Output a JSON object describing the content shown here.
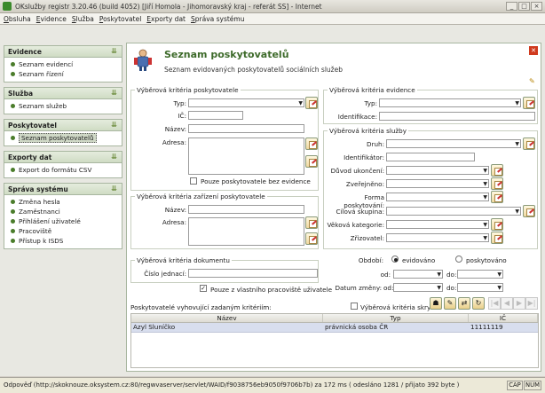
{
  "window": {
    "title": "OKslužby registr 3.20.46 (build 4052) [Jiří Homola - Jihomoravský kraj - referát SS] - Internet",
    "controls": [
      "_",
      "□",
      "×"
    ]
  },
  "menu": [
    "Obsluha",
    "Evidence",
    "Služba",
    "Poskytovatel",
    "Exporty dat",
    "Správa systému"
  ],
  "sidebar": [
    {
      "title": "Evidence",
      "items": [
        "Seznam evidencí",
        "Seznam řízení"
      ]
    },
    {
      "title": "Služba",
      "items": [
        "Seznam služeb"
      ]
    },
    {
      "title": "Poskytovatel",
      "items": [
        "Seznam poskytovatelů"
      ],
      "active": 0
    },
    {
      "title": "Exporty dat",
      "items": [
        "Export do formátu CSV"
      ]
    },
    {
      "title": "Správa systému",
      "items": [
        "Změna hesla",
        "Zaměstnanci",
        "Přihlášení uživatelé",
        "Pracoviště",
        "Přístup k ISDS"
      ]
    }
  ],
  "page": {
    "title": "Seznam poskytovatelů",
    "subtitle": "Seznam evidovaných poskytovatelů sociálních služeb"
  },
  "provider_criteria": {
    "legend": "Výběrová kritéria poskytovatele",
    "typ": "Typ:",
    "ic": "IČ:",
    "nazev": "Název:",
    "adresa": "Adresa:",
    "checkbox": "Pouze poskytovatele bez evidence"
  },
  "facility_criteria": {
    "legend": "Výběrová kritéria zařízení poskytovatele",
    "nazev": "Název:",
    "adresa": "Adresa:"
  },
  "document_criteria": {
    "legend": "Výběrová kritéria dokumentu",
    "cislo": "Číslo jednací:"
  },
  "own_workplace": {
    "label": "Pouze z vlastního pracoviště uživatele",
    "checked": "✓"
  },
  "evidence_criteria": {
    "legend": "Výběrová kritéria evidence",
    "typ": "Typ:",
    "identifikace": "Identifikace:"
  },
  "service_criteria": {
    "legend": "Výběrová kritéria služby",
    "fields": [
      "Druh:",
      "Identifikátor:",
      "Důvod ukončení:",
      "Zveřejněno:",
      "Forma poskytování:",
      "Cílová skupina:",
      "Věková kategorie:",
      "Zřizovatel:"
    ]
  },
  "period": {
    "label": "Období:",
    "opt1": "evidováno",
    "opt2": "poskytováno",
    "od": "od:",
    "do": "do:",
    "datum": "Datum změny:"
  },
  "results": {
    "label": "Poskytovatelé vyhovující zadaným kritériím:",
    "hidden_label": "Výběrová kritéria skryta",
    "columns": [
      "Název",
      "Typ",
      "IČ"
    ],
    "rows": [
      {
        "nazev": "Azyl Sluníčko",
        "typ": "právnická osoba ČR",
        "ic": "11111119"
      }
    ]
  },
  "status": {
    "text": "Odpověď (http://skoknouze.oksystem.cz:80/regwvaserver/servlet/WAID/f9038756eb9050f9706b7b) za 172 ms ( odesláno 1281 / přijato 392 byte )",
    "cap": "CAP",
    "num": "NUM"
  },
  "colors": {
    "accent": "#3d6a2a",
    "selection": "#d8deee",
    "close": "#d03a1e"
  }
}
